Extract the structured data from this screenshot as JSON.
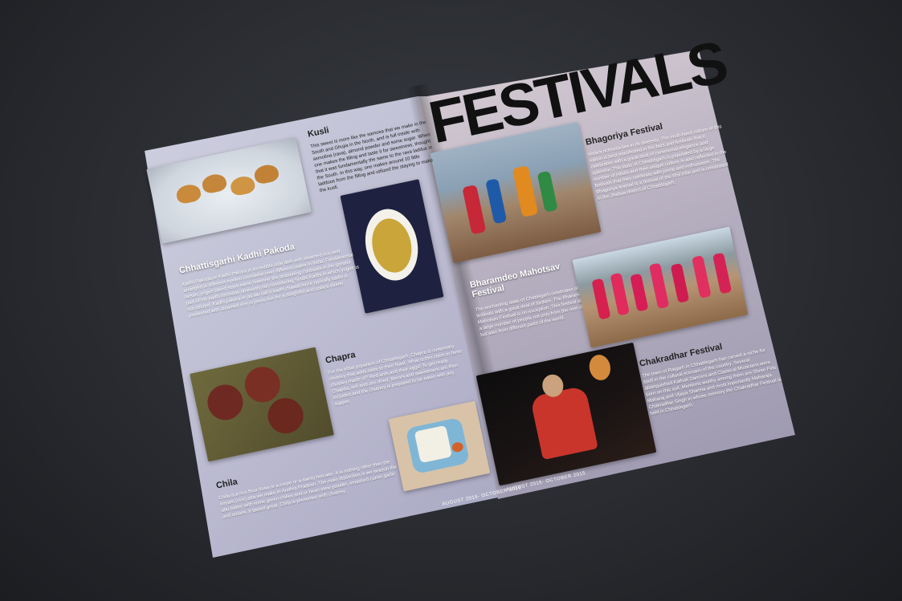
{
  "masthead": {
    "title": "FESTIVALS"
  },
  "left_page": {
    "kusli": {
      "title": "Kusli",
      "text": "This sweet is more like the samosa that we make in the South and Ghujia in the North, and is full inside with semolina (rava), almond powder and some sugar. When one makes the filling and taste it for sweetness, thought that it was fundamentally the same to the rava laddus in the South. In this way, one makes around 10 little laddoos from the filling and utilized the staying to make the kusli."
    },
    "kadhi": {
      "title": "Chhattisgarhi Kadhi Pakoda",
      "text": "Kadhi Pakoda or Kadhi Pakora is incredible side dish with steamed rice and arranged in different system crosswise over different states in India. Fundamental besan, yogurt blend stays same however the seasoning contrasts in the greater part of the kadhi formulas obviously not considering Sindhi Kadhi in which yogurt is not utilized. Kadhi pakora or as we call it kadhi chawal since typically kadhi is presented with steamed rice or jeera rice for a delightful and solace dinner."
    },
    "chapra": {
      "title": "Chapra",
      "text": "For the tribal populace of Chhattisgarh, Chapra is customary chutney that adds taste to their feast. What is this claim to fame chutney made of? Red ants and their eggs! To get ready Chapda, red ants are dried. flavors and sweeteners are then included and the chutney is prepared to be eaten with any supper."
    },
    "chila": {
      "title": "Chila",
      "text": "Chila is a rice flour dosa or a crepe or a dainty hotcake. It is nothing other than the biryam (rice) atta we make in Andhra Pradesh. The main distinction is we season the attu batter with some green chilies and or bean stew powder, smashed cumin garlic and onions. It tasted great. Chila is presented with chutney."
    },
    "footer": "AUGUST 2015- OCTOBER 2015"
  },
  "right_page": {
    "bhagoriya": {
      "title": "Bhagoriya Festival",
      "text": "India's richness lies in its diversity. The multi-hued culture of this nation is best manifested in the fairs and festivals that it celebrates with a great deal of ceremonial elegance and splendor. The state of Chhattisgarh is populated by a large number of tribals and their unique culture is also reflected in the festivals that they celebrate with pomp and enthusiasm. The Bhagoriya festival is a festival of the Bhil tribe and is celebrated in the Jhabua district of Chhattisgarh."
    },
    "bharamdeo": {
      "title": "Bharamdeo Mahotsav Festival",
      "text": "The enchanting state of Chattisgarh celebrates all its festivals with a great deal of fanfare. The Bharamdeo Mahotsav Festival is no exception. This festival attracts a large number of people not only from the rest of India but also from different parts of the world."
    },
    "chakradhar": {
      "title": "Chakradhar Festival",
      "text": "The town of Raigarh in Chhattisgarh has carved a niche for itself in the cultural scenario of the country. Several distinguished Kathak Dancers and Classical Musicians were born on this soil. Mentions worthy among them are Shree Firtu Maharaj and Vijaya Sharma and most importantly Maharaja Chakradhar Singh in whose memory the Chakradhar Festival is held in Chhattisgarh."
    },
    "footer": "AUGUST 2015- OCTOBER 2015"
  }
}
